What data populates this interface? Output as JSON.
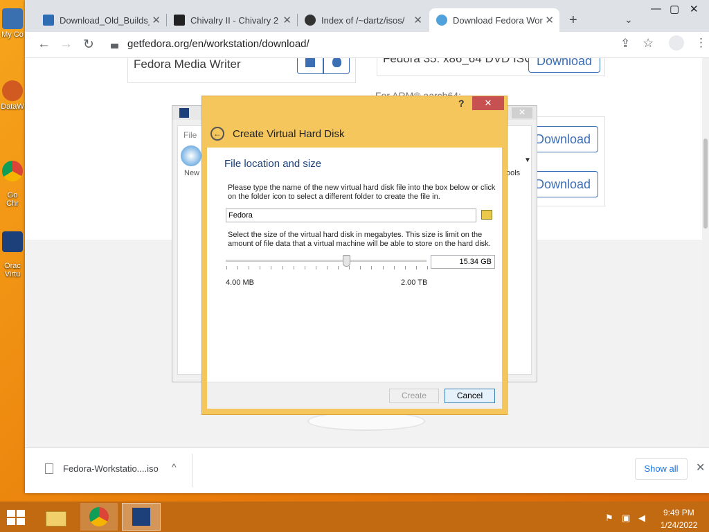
{
  "desktop": {
    "icons": [
      {
        "label": "My Co",
        "icon": "computer-icon"
      },
      {
        "label": "DataW",
        "icon": "datawrapper-icon"
      },
      {
        "label": "Go\nChr",
        "icon": "chrome-icon"
      },
      {
        "label": "Orac\nVirtu",
        "icon": "virtualbox-icon"
      }
    ]
  },
  "browser": {
    "tabs": [
      {
        "label": "Download_Old_Builds_S",
        "active": false
      },
      {
        "label": "Chivalry II - Chivalry 2",
        "active": false
      },
      {
        "label": "Index of /~dartz/isos/",
        "active": false
      },
      {
        "label": "Download Fedora Work",
        "active": true
      }
    ],
    "new_tab": "+",
    "url": "getfedora.org/en/workstation/download/"
  },
  "page": {
    "media_writer": "Fedora Media Writer",
    "iso_title": "Fedora 35: x86_64 DVD ISO",
    "download_label": "Download",
    "arm_label": "For ARM® aarch64:"
  },
  "vbox_bg": {
    "file_menu": "File",
    "new_label": "New",
    "tools_label": "ools"
  },
  "dialog": {
    "help": "?",
    "close": "✕",
    "title": "Create Virtual Hard Disk",
    "section": "File location and size",
    "desc1": "Please type the name of the new virtual hard disk file into the box below or click on the folder icon to select a different folder to create the file in.",
    "filename": "Fedora",
    "desc2": "Select the size of the virtual hard disk in megabytes. This size is limit on the amount of file data that a virtual machine will be able to store on the hard disk.",
    "size_value": "15.34 GB",
    "slider_min": "4.00 MB",
    "slider_max": "2.00 TB",
    "slider_fraction": 0.6,
    "create_label": "Create",
    "cancel_label": "Cancel"
  },
  "downloads": {
    "file": "Fedora-Workstatio....iso",
    "show_all": "Show all"
  },
  "taskbar": {
    "time": "9:49 PM",
    "date": "1/24/2022"
  }
}
